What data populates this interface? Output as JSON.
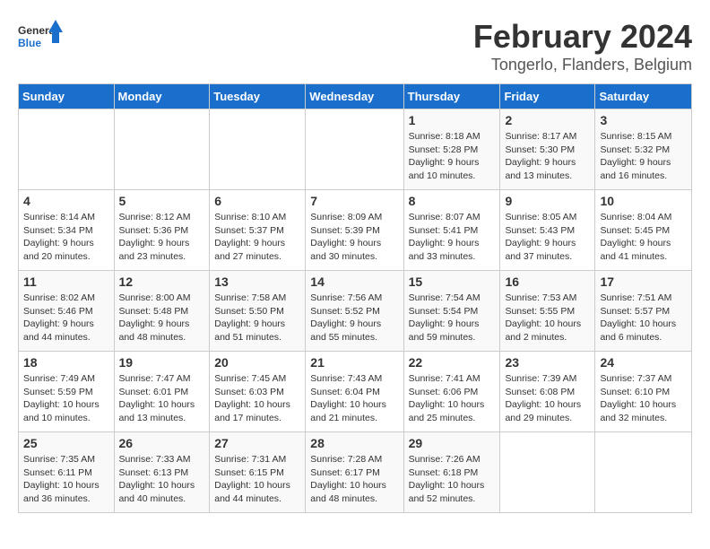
{
  "header": {
    "logo_general": "General",
    "logo_blue": "Blue",
    "month_title": "February 2024",
    "location": "Tongerlo, Flanders, Belgium"
  },
  "days_of_week": [
    "Sunday",
    "Monday",
    "Tuesday",
    "Wednesday",
    "Thursday",
    "Friday",
    "Saturday"
  ],
  "weeks": [
    [
      {
        "day": "",
        "info": ""
      },
      {
        "day": "",
        "info": ""
      },
      {
        "day": "",
        "info": ""
      },
      {
        "day": "",
        "info": ""
      },
      {
        "day": "1",
        "info": "Sunrise: 8:18 AM\nSunset: 5:28 PM\nDaylight: 9 hours\nand 10 minutes."
      },
      {
        "day": "2",
        "info": "Sunrise: 8:17 AM\nSunset: 5:30 PM\nDaylight: 9 hours\nand 13 minutes."
      },
      {
        "day": "3",
        "info": "Sunrise: 8:15 AM\nSunset: 5:32 PM\nDaylight: 9 hours\nand 16 minutes."
      }
    ],
    [
      {
        "day": "4",
        "info": "Sunrise: 8:14 AM\nSunset: 5:34 PM\nDaylight: 9 hours\nand 20 minutes."
      },
      {
        "day": "5",
        "info": "Sunrise: 8:12 AM\nSunset: 5:36 PM\nDaylight: 9 hours\nand 23 minutes."
      },
      {
        "day": "6",
        "info": "Sunrise: 8:10 AM\nSunset: 5:37 PM\nDaylight: 9 hours\nand 27 minutes."
      },
      {
        "day": "7",
        "info": "Sunrise: 8:09 AM\nSunset: 5:39 PM\nDaylight: 9 hours\nand 30 minutes."
      },
      {
        "day": "8",
        "info": "Sunrise: 8:07 AM\nSunset: 5:41 PM\nDaylight: 9 hours\nand 33 minutes."
      },
      {
        "day": "9",
        "info": "Sunrise: 8:05 AM\nSunset: 5:43 PM\nDaylight: 9 hours\nand 37 minutes."
      },
      {
        "day": "10",
        "info": "Sunrise: 8:04 AM\nSunset: 5:45 PM\nDaylight: 9 hours\nand 41 minutes."
      }
    ],
    [
      {
        "day": "11",
        "info": "Sunrise: 8:02 AM\nSunset: 5:46 PM\nDaylight: 9 hours\nand 44 minutes."
      },
      {
        "day": "12",
        "info": "Sunrise: 8:00 AM\nSunset: 5:48 PM\nDaylight: 9 hours\nand 48 minutes."
      },
      {
        "day": "13",
        "info": "Sunrise: 7:58 AM\nSunset: 5:50 PM\nDaylight: 9 hours\nand 51 minutes."
      },
      {
        "day": "14",
        "info": "Sunrise: 7:56 AM\nSunset: 5:52 PM\nDaylight: 9 hours\nand 55 minutes."
      },
      {
        "day": "15",
        "info": "Sunrise: 7:54 AM\nSunset: 5:54 PM\nDaylight: 9 hours\nand 59 minutes."
      },
      {
        "day": "16",
        "info": "Sunrise: 7:53 AM\nSunset: 5:55 PM\nDaylight: 10 hours\nand 2 minutes."
      },
      {
        "day": "17",
        "info": "Sunrise: 7:51 AM\nSunset: 5:57 PM\nDaylight: 10 hours\nand 6 minutes."
      }
    ],
    [
      {
        "day": "18",
        "info": "Sunrise: 7:49 AM\nSunset: 5:59 PM\nDaylight: 10 hours\nand 10 minutes."
      },
      {
        "day": "19",
        "info": "Sunrise: 7:47 AM\nSunset: 6:01 PM\nDaylight: 10 hours\nand 13 minutes."
      },
      {
        "day": "20",
        "info": "Sunrise: 7:45 AM\nSunset: 6:03 PM\nDaylight: 10 hours\nand 17 minutes."
      },
      {
        "day": "21",
        "info": "Sunrise: 7:43 AM\nSunset: 6:04 PM\nDaylight: 10 hours\nand 21 minutes."
      },
      {
        "day": "22",
        "info": "Sunrise: 7:41 AM\nSunset: 6:06 PM\nDaylight: 10 hours\nand 25 minutes."
      },
      {
        "day": "23",
        "info": "Sunrise: 7:39 AM\nSunset: 6:08 PM\nDaylight: 10 hours\nand 29 minutes."
      },
      {
        "day": "24",
        "info": "Sunrise: 7:37 AM\nSunset: 6:10 PM\nDaylight: 10 hours\nand 32 minutes."
      }
    ],
    [
      {
        "day": "25",
        "info": "Sunrise: 7:35 AM\nSunset: 6:11 PM\nDaylight: 10 hours\nand 36 minutes."
      },
      {
        "day": "26",
        "info": "Sunrise: 7:33 AM\nSunset: 6:13 PM\nDaylight: 10 hours\nand 40 minutes."
      },
      {
        "day": "27",
        "info": "Sunrise: 7:31 AM\nSunset: 6:15 PM\nDaylight: 10 hours\nand 44 minutes."
      },
      {
        "day": "28",
        "info": "Sunrise: 7:28 AM\nSunset: 6:17 PM\nDaylight: 10 hours\nand 48 minutes."
      },
      {
        "day": "29",
        "info": "Sunrise: 7:26 AM\nSunset: 6:18 PM\nDaylight: 10 hours\nand 52 minutes."
      },
      {
        "day": "",
        "info": ""
      },
      {
        "day": "",
        "info": ""
      }
    ]
  ]
}
